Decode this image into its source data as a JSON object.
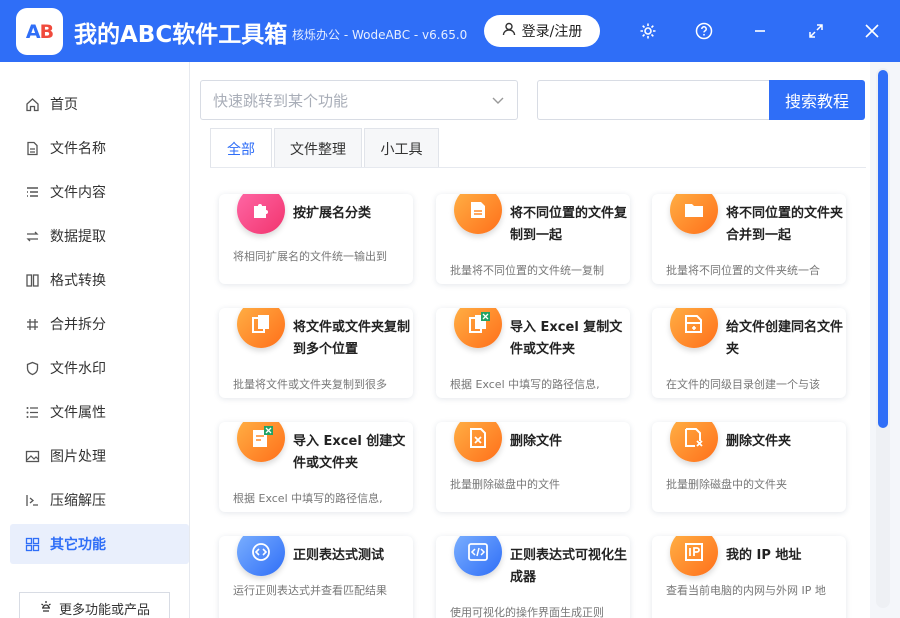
{
  "app": {
    "title": "我的ABC软件工具箱",
    "subtitle": "核烁办公 - WodeABC - v6.65.0",
    "logo_text_a": "A",
    "logo_text_b": "B",
    "login_label": "登录/注册",
    "accent": "#2f6ef7"
  },
  "titlebar_icons": [
    "gear-icon",
    "help-icon",
    "minimize-icon",
    "maximize-icon",
    "close-icon"
  ],
  "sidebar": {
    "items": [
      {
        "label": "首页",
        "icon": "home-icon"
      },
      {
        "label": "文件名称",
        "icon": "file-name-icon"
      },
      {
        "label": "文件内容",
        "icon": "file-content-icon"
      },
      {
        "label": "数据提取",
        "icon": "extract-icon"
      },
      {
        "label": "格式转换",
        "icon": "convert-icon"
      },
      {
        "label": "合并拆分",
        "icon": "merge-icon"
      },
      {
        "label": "文件水印",
        "icon": "watermark-icon"
      },
      {
        "label": "文件属性",
        "icon": "attributes-icon"
      },
      {
        "label": "图片处理",
        "icon": "image-icon"
      },
      {
        "label": "压缩解压",
        "icon": "compress-icon"
      },
      {
        "label": "其它功能",
        "icon": "grid-icon",
        "active": true
      }
    ],
    "more_label": "更多功能或产品"
  },
  "search": {
    "jump_placeholder": "快速跳转到某个功能",
    "input_value": "",
    "button_label": "搜索教程"
  },
  "tabs": [
    {
      "label": "全部",
      "active": true
    },
    {
      "label": "文件整理",
      "active": false
    },
    {
      "label": "小工具",
      "active": false
    }
  ],
  "cards": [
    {
      "title": "按扩展名分类",
      "desc": "将相同扩展名的文件统一输出到",
      "icon": "puzzle-icon",
      "color": "pink"
    },
    {
      "title": "将不同位置的文件复制到一起",
      "desc": "批量将不同位置的文件统一复制",
      "icon": "file-copy-icon",
      "color": "orange"
    },
    {
      "title": "将不同位置的文件夹合并到一起",
      "desc": "批量将不同位置的文件夹统一合",
      "icon": "folder-icon",
      "color": "orange"
    },
    {
      "title": "将文件或文件夹复制到多个位置",
      "desc": "批量将文件或文件夹复制到很多",
      "icon": "multi-copy-icon",
      "color": "orange"
    },
    {
      "title": "导入 Excel 复制文件或文件夹",
      "desc": "根据 Excel 中填写的路径信息,",
      "icon": "excel-copy-icon",
      "color": "orange"
    },
    {
      "title": "给文件创建同名文件夹",
      "desc": "在文件的同级目录创建一个与该",
      "icon": "folder-add-icon",
      "color": "orange"
    },
    {
      "title": "导入 Excel 创建文件或文件夹",
      "desc": "根据 Excel 中填写的路径信息,",
      "icon": "excel-create-icon",
      "color": "orange"
    },
    {
      "title": "删除文件",
      "desc": "批量删除磁盘中的文件",
      "icon": "file-delete-icon",
      "color": "orange"
    },
    {
      "title": "删除文件夹",
      "desc": "批量删除磁盘中的文件夹",
      "icon": "folder-delete-icon",
      "color": "orange"
    },
    {
      "title": "正则表达式测试",
      "desc": "运行正则表达式并查看匹配结果",
      "icon": "regex-icon",
      "color": "blue"
    },
    {
      "title": "正则表达式可视化生成器",
      "desc": "使用可视化的操作界面生成正则",
      "icon": "code-icon",
      "color": "blue"
    },
    {
      "title": "我的 IP 地址",
      "desc": "查看当前电脑的内网与外网 IP 地",
      "icon": "ip-icon",
      "color": "orange"
    }
  ]
}
